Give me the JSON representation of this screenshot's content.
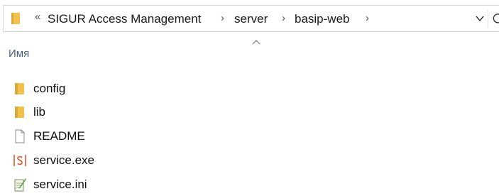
{
  "address_bar": {
    "overflow_glyph": "«",
    "crumbs": [
      "SIGUR Access Management",
      "server",
      "basip-web"
    ],
    "separator": "›"
  },
  "column_header": {
    "name_label": "Имя"
  },
  "files": [
    {
      "name": "config",
      "icon": "folder-icon"
    },
    {
      "name": "lib",
      "icon": "folder-icon"
    },
    {
      "name": "README",
      "icon": "document-icon"
    },
    {
      "name": "service.exe",
      "icon": "executable-icon"
    },
    {
      "name": "service.ini",
      "icon": "settings-file-icon"
    }
  ],
  "colors": {
    "folder": "#f0c24b",
    "exe_icon": "#e0572b",
    "header_text": "#4c607a"
  }
}
